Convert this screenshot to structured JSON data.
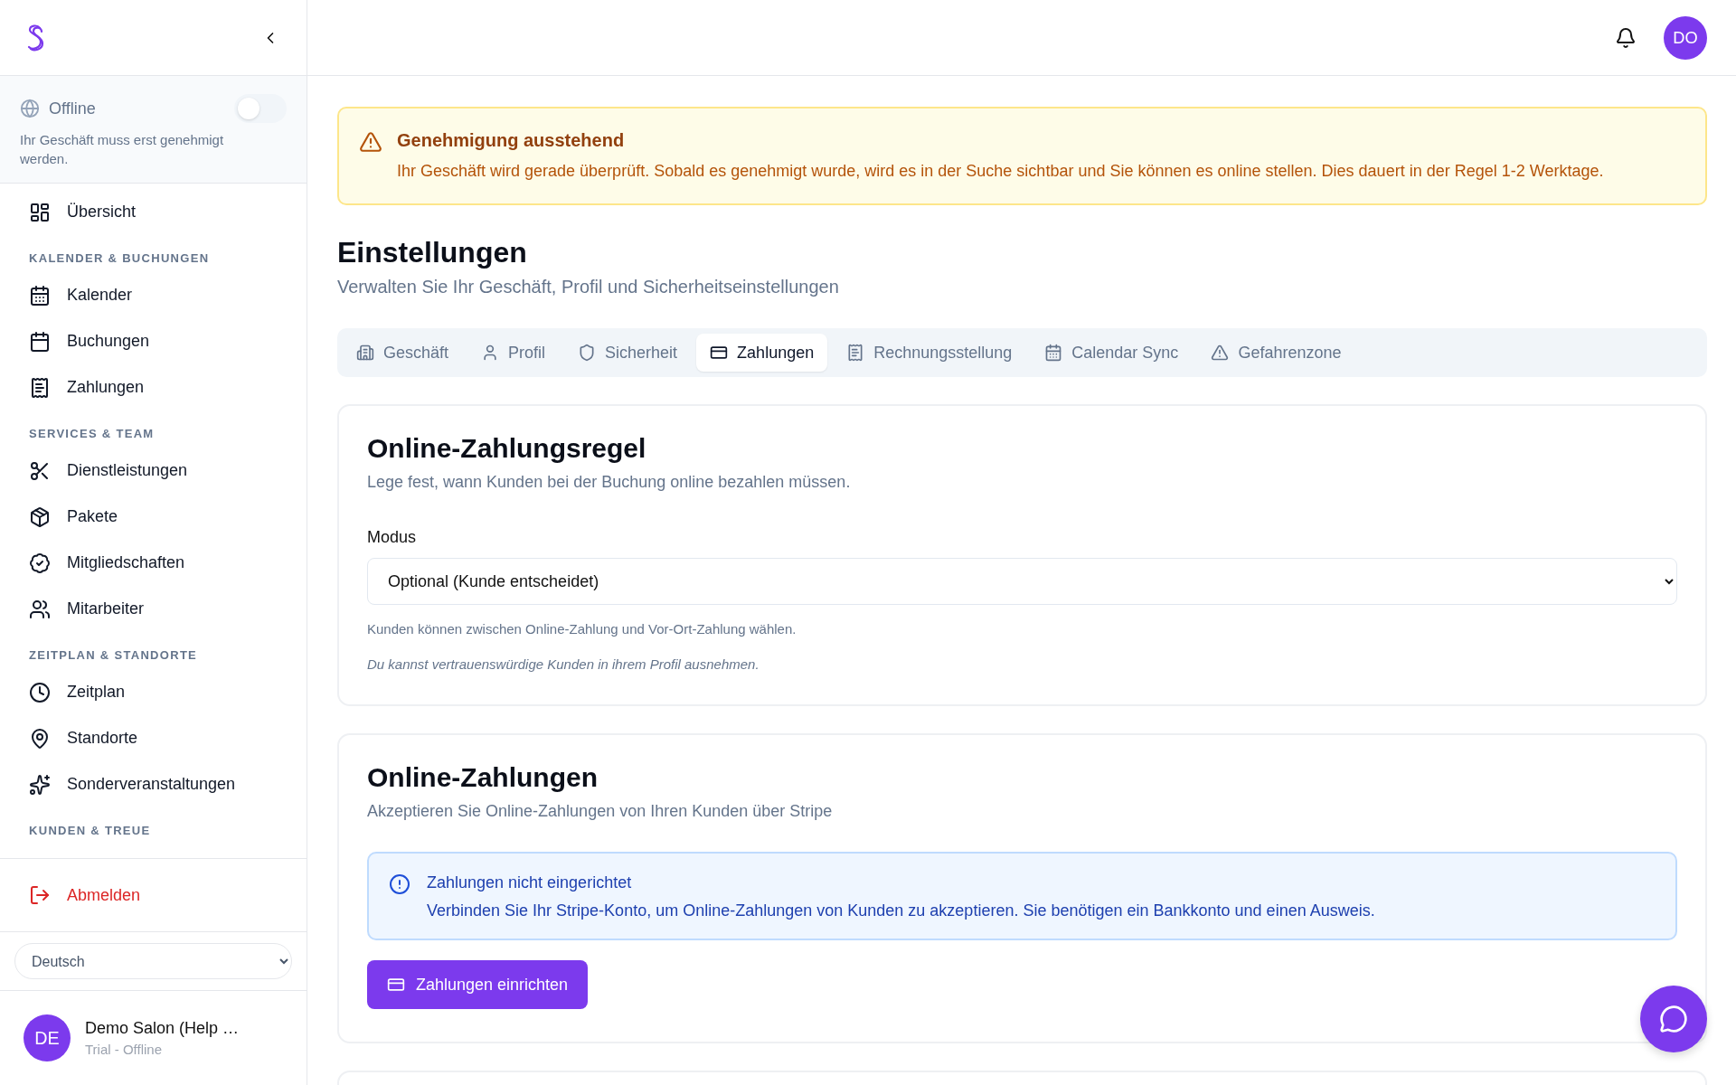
{
  "sidebar": {
    "status": {
      "label": "Offline",
      "on": false,
      "message": "Ihr Geschäft muss erst genehmigt werden."
    },
    "overview": {
      "label": "Übersicht"
    },
    "sections": [
      {
        "heading": "KALENDER & BUCHUNGEN",
        "items": [
          {
            "label": "Kalender"
          },
          {
            "label": "Buchungen"
          },
          {
            "label": "Zahlungen"
          }
        ]
      },
      {
        "heading": "SERVICES & TEAM",
        "items": [
          {
            "label": "Dienstleistungen"
          },
          {
            "label": "Pakete"
          },
          {
            "label": "Mitgliedschaften"
          },
          {
            "label": "Mitarbeiter"
          }
        ]
      },
      {
        "heading": "ZEITPLAN & STANDORTE",
        "items": [
          {
            "label": "Zeitplan"
          },
          {
            "label": "Standorte"
          },
          {
            "label": "Sonderveranstaltungen"
          }
        ]
      },
      {
        "heading": "KUNDEN & TREUE"
      }
    ],
    "logout": "Abmelden",
    "language": "Deutsch",
    "account": {
      "initials": "DE",
      "name": "Demo Salon (Help …",
      "status": "Trial - Offline"
    }
  },
  "header": {
    "avatar": "DO"
  },
  "alert": {
    "title": "Genehmigung ausstehend",
    "message": "Ihr Geschäft wird gerade überprüft. Sobald es genehmigt wurde, wird es in der Suche sichtbar und Sie können es online stellen. Dies dauert in der Regel 1-2 Werktage."
  },
  "page": {
    "title": "Einstellungen",
    "subtitle": "Verwalten Sie Ihr Geschäft, Profil und Sicherheitseinstellungen"
  },
  "tabs": [
    {
      "label": "Geschäft",
      "selected": false
    },
    {
      "label": "Profil",
      "selected": false
    },
    {
      "label": "Sicherheit",
      "selected": false
    },
    {
      "label": "Zahlungen",
      "selected": true
    },
    {
      "label": "Rechnungsstellung",
      "selected": false
    },
    {
      "label": "Calendar Sync",
      "selected": false
    },
    {
      "label": "Gefahrenzone",
      "selected": false
    }
  ],
  "rule_card": {
    "title": "Online-Zahlungsregel",
    "description": "Lege fest, wann Kunden bei der Buchung online bezahlen müssen.",
    "field_label": "Modus",
    "value": "Optional (Kunde entscheidet)",
    "help": "Kunden können zwischen Online-Zahlung und Vor-Ort-Zahlung wählen.",
    "note": "Du kannst vertrauenswürdige Kunden in ihrem Profil ausnehmen."
  },
  "payments_card": {
    "title": "Online-Zahlungen",
    "description": "Akzeptieren Sie Online-Zahlungen von Ihren Kunden über Stripe",
    "info": {
      "title": "Zahlungen nicht eingerichtet",
      "message": "Verbinden Sie Ihr Stripe-Konto, um Online-Zahlungen von Kunden zu akzeptieren. Sie benötigen ein Bankkonto und einen Ausweis."
    },
    "button": "Zahlungen einrichten"
  }
}
